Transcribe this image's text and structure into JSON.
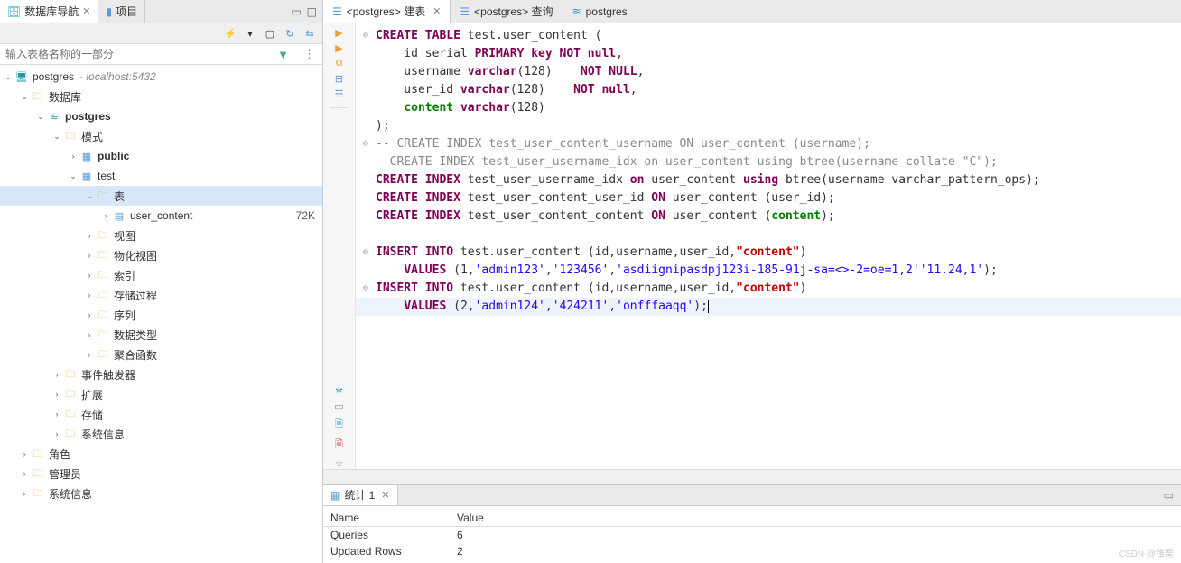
{
  "leftTabs": [
    {
      "icon": "🗄",
      "label": "数据库导航",
      "close": true
    },
    {
      "icon": "☰",
      "label": "项目",
      "close": false
    }
  ],
  "searchPlaceholder": "输入表格名称的一部分",
  "tree": {
    "conn": {
      "name": "postgres",
      "host": "- localhost:5432"
    },
    "dbfolder": "数据库",
    "db": "postgres",
    "schemaFolder": "模式",
    "schemas": {
      "public": "public",
      "test": "test"
    },
    "tablesFolder": "表",
    "table": {
      "name": "user_content",
      "size": "72K"
    },
    "testSubs": [
      "视图",
      "物化视图",
      "索引",
      "存储过程",
      "序列",
      "数据类型",
      "聚合函数"
    ],
    "dbSubs": [
      "事件触发器",
      "扩展",
      "存储",
      "系统信息"
    ],
    "connSubs": [
      "角色",
      "管理员",
      "系统信息"
    ]
  },
  "editorTabs": [
    {
      "icon": "☰",
      "label": "<postgres> 建表",
      "active": true,
      "close": true
    },
    {
      "icon": "☰",
      "label": "<postgres> 查询",
      "active": false,
      "close": false
    },
    {
      "icon": "≋",
      "label": "postgres",
      "active": false,
      "close": false
    }
  ],
  "code": {
    "l1": [
      "CREATE TABLE",
      " test.user_content ("
    ],
    "l2": [
      "    id serial ",
      "PRIMARY key NOT null",
      ","
    ],
    "l3": [
      "    username ",
      "varchar",
      "(",
      "128",
      ")    ",
      "NOT NULL",
      ","
    ],
    "l4": [
      "    user_id ",
      "varchar",
      "(",
      "128",
      ")    ",
      "NOT null",
      ","
    ],
    "l5": [
      "    ",
      "content",
      " ",
      "varchar",
      "(",
      "128",
      ")"
    ],
    "l6": [
      ");"
    ],
    "l7": [
      "-- CREATE INDEX test_user_content_username ON user_content (username);"
    ],
    "l8": [
      "--CREATE INDEX test_user_username_idx on user_content using btree(username collate \"C\");"
    ],
    "l9a": "CREATE INDEX",
    "l9b": " test_user_username_idx ",
    "l9c": "on",
    "l9d": " user_content ",
    "l9e": "using",
    "l9f": " btree(username varchar_pattern_ops);",
    "l10a": "CREATE INDEX",
    "l10b": " test_user_content_user_id ",
    "l10c": "ON",
    "l10d": " user_content (user_id);",
    "l11a": "CREATE INDEX",
    "l11b": " test_user_content_content ",
    "l11c": "ON",
    "l11d": " user_content (",
    "l11e": "content",
    "l11f": ");",
    "l12a": "INSERT INTO",
    "l12b": " test.user_content (id,username,user_id,",
    "l12c": "\"content\"",
    "l12d": ")",
    "l13a": "    ",
    "l13b": "VALUES",
    "l13c": " (",
    "l13d": "1",
    "l13e": ",",
    "l13f": "'admin123'",
    "l13g": ",",
    "l13h": "'123456'",
    "l13i": ",",
    "l13j": "'asdiignipasdpj123i-185-91j-sa=<>-2=oe=1,2''11.24,1'",
    "l13k": ");",
    "l14a": "INSERT INTO",
    "l14b": " test.user_content (id,username,user_id,",
    "l14c": "\"content\"",
    "l14d": ")",
    "l15a": "    ",
    "l15b": "VALUES",
    "l15c": " (",
    "l15d": "2",
    "l15e": ",",
    "l15f": "'admin124'",
    "l15g": ",",
    "l15h": "'424211'",
    "l15i": ",",
    "l15j": "'onfffaaqq'",
    "l15k": ");"
  },
  "bottomTab": "统计 1",
  "stats": {
    "headName": "Name",
    "headVal": "Value",
    "rows": [
      {
        "name": "Queries",
        "value": "6"
      },
      {
        "name": "Updated Rows",
        "value": "2"
      }
    ]
  },
  "watermark": "CSDN @锥栗"
}
